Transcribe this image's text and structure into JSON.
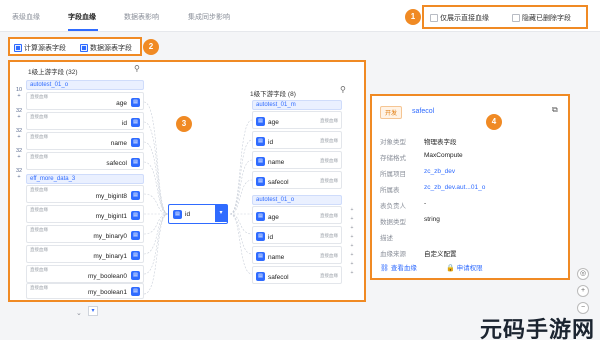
{
  "tabs": [
    {
      "label": "表级血缘"
    },
    {
      "label": "字段血缘"
    },
    {
      "label": "数据表影响"
    },
    {
      "label": "集成同步影响"
    }
  ],
  "options": {
    "show_direct": "仅展示直接血缘",
    "hide_deleted": "隐藏已删除字段"
  },
  "legend": {
    "computed": "计算源表字段",
    "datasource": "数据源表字段"
  },
  "callouts": [
    "1",
    "2",
    "3",
    "4"
  ],
  "upstream": {
    "title": "1级上游字段 (32)",
    "counts": [
      "10",
      "32",
      "32",
      "32",
      "32"
    ],
    "group1": {
      "name": "autotest_01_o",
      "tag": "直接血缘",
      "fields": [
        "age",
        "id",
        "name",
        "safecol"
      ]
    },
    "group2": {
      "name": "eff_more_data_3",
      "tag": "直接血缘",
      "fields": [
        "my_bigint8",
        "my_bigint1",
        "my_binary0",
        "my_binary1",
        "my_boolean0",
        "my_boolean1"
      ]
    }
  },
  "center": {
    "field": "id",
    "icon": "id-field-icon"
  },
  "downstream": {
    "title": "1级下游字段 (8)",
    "group1": {
      "name": "autotest_01_m",
      "tag": "直接血缘",
      "fields": [
        "age",
        "id",
        "name",
        "safecol"
      ]
    },
    "group2": {
      "name": "autotest_01_o",
      "tag": "直接血缘",
      "fields": [
        "age",
        "id",
        "name",
        "safecol"
      ]
    }
  },
  "detail": {
    "tag": "开发",
    "name": "safecol",
    "rows": [
      {
        "k": "对象类型",
        "v": "物理表字段"
      },
      {
        "k": "存储格式",
        "v": "MaxCompute"
      },
      {
        "k": "所属项目",
        "v": "zc_zb_dev",
        "link": true
      },
      {
        "k": "所属表",
        "v": "zc_zb_dev.aut...01_o",
        "link": true
      },
      {
        "k": "表负责人",
        "v": "-"
      },
      {
        "k": "数据类型",
        "v": "string"
      },
      {
        "k": "描述",
        "v": ""
      },
      {
        "k": "血缘来源",
        "v": "自定义配置"
      }
    ],
    "action_lineage": "查看血缘",
    "action_perm": "申请权限"
  },
  "watermark": "元码手游网",
  "colors": {
    "accent": "#2f6bff",
    "callout": "#f08a24"
  }
}
